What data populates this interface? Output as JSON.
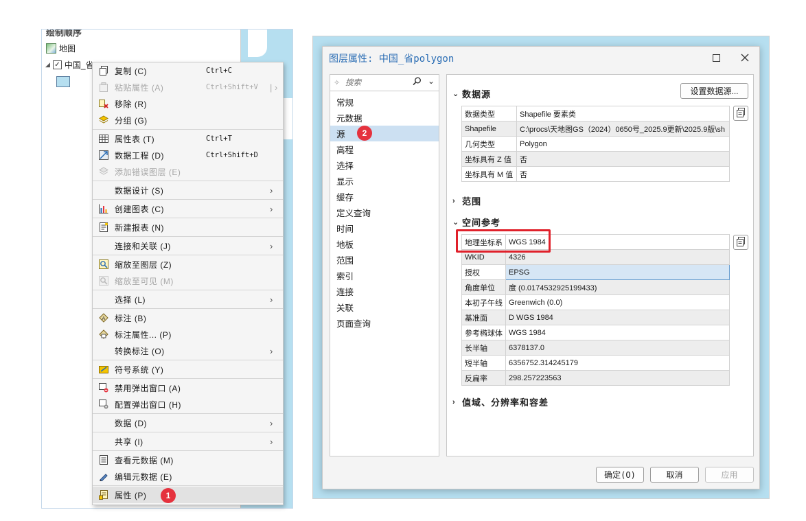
{
  "toc": {
    "title": "绘制顺序",
    "map_label": "地图",
    "layer_label": "中国_省"
  },
  "context_menu": {
    "items": [
      {
        "label": "复制 (C)",
        "shortcut": "Ctrl+C",
        "icon": "copy-icon",
        "disabled": false,
        "submenu": false
      },
      {
        "label": "粘贴属性 (A)",
        "shortcut": "Ctrl+Shift+V",
        "icon": "paste-icon",
        "disabled": true,
        "submenu": true
      },
      {
        "label": "移除 (R)",
        "shortcut": "",
        "icon": "remove-icon",
        "disabled": false,
        "submenu": false
      },
      {
        "label": "分组 (G)",
        "shortcut": "",
        "icon": "group-icon",
        "disabled": false,
        "submenu": false
      },
      {
        "label": "属性表 (T)",
        "shortcut": "Ctrl+T",
        "icon": "attribute-table-icon",
        "disabled": false,
        "submenu": false
      },
      {
        "label": "数据工程 (D)",
        "shortcut": "Ctrl+Shift+D",
        "icon": "data-engineering-icon",
        "disabled": false,
        "submenu": false
      },
      {
        "label": "添加错误图层 (E)",
        "shortcut": "",
        "icon": "error-layer-icon",
        "disabled": true,
        "submenu": false
      },
      {
        "label": "数据设计 (S)",
        "shortcut": "",
        "icon": "",
        "disabled": false,
        "submenu": true
      },
      {
        "label": "创建图表 (C)",
        "shortcut": "",
        "icon": "chart-icon",
        "disabled": false,
        "submenu": true
      },
      {
        "label": "新建报表 (N)",
        "shortcut": "",
        "icon": "report-icon",
        "disabled": false,
        "submenu": false
      },
      {
        "label": "连接和关联 (J)",
        "shortcut": "",
        "icon": "",
        "disabled": false,
        "submenu": true
      },
      {
        "label": "缩放至图层 (Z)",
        "shortcut": "",
        "icon": "zoom-layer-icon",
        "disabled": false,
        "submenu": false
      },
      {
        "label": "缩放至可见 (M)",
        "shortcut": "",
        "icon": "zoom-visible-icon",
        "disabled": true,
        "submenu": false
      },
      {
        "label": "选择 (L)",
        "shortcut": "",
        "icon": "",
        "disabled": false,
        "submenu": true
      },
      {
        "label": "标注 (B)",
        "shortcut": "",
        "icon": "label-icon",
        "disabled": false,
        "submenu": false
      },
      {
        "label": "标注属性... (P)",
        "shortcut": "",
        "icon": "label-properties-icon",
        "disabled": false,
        "submenu": false
      },
      {
        "label": "转换标注 (O)",
        "shortcut": "",
        "icon": "",
        "disabled": false,
        "submenu": true
      },
      {
        "label": "符号系统 (Y)",
        "shortcut": "",
        "icon": "symbology-icon",
        "disabled": false,
        "submenu": false
      },
      {
        "label": "禁用弹出窗口 (A)",
        "shortcut": "",
        "icon": "disable-popup-icon",
        "disabled": false,
        "submenu": false
      },
      {
        "label": "配置弹出窗口 (H)",
        "shortcut": "",
        "icon": "configure-popup-icon",
        "disabled": false,
        "submenu": false
      },
      {
        "label": "数据 (D)",
        "shortcut": "",
        "icon": "",
        "disabled": false,
        "submenu": true
      },
      {
        "label": "共享 (I)",
        "shortcut": "",
        "icon": "",
        "disabled": false,
        "submenu": true
      },
      {
        "label": "查看元数据 (M)",
        "shortcut": "",
        "icon": "view-metadata-icon",
        "disabled": false,
        "submenu": false
      },
      {
        "label": "编辑元数据 (E)",
        "shortcut": "",
        "icon": "edit-metadata-icon",
        "disabled": false,
        "submenu": false
      },
      {
        "label": "属性 (P)",
        "shortcut": "",
        "icon": "properties-icon",
        "disabled": false,
        "submenu": false
      }
    ]
  },
  "badges": {
    "one": "1",
    "two": "2"
  },
  "dialog": {
    "title": "图层属性: 中国_省polygon",
    "search_placeholder": "搜索",
    "nav_items": [
      "常规",
      "元数据",
      "源",
      "高程",
      "选择",
      "显示",
      "缓存",
      "定义查询",
      "时间",
      "地板",
      "范围",
      "索引",
      "连接",
      "关联",
      "页面查询"
    ],
    "selected_nav": "源",
    "data_source": {
      "heading": "数据源",
      "set_button": "设置数据源...",
      "rows": [
        {
          "key": "数据类型",
          "value": "Shapefile 要素类"
        },
        {
          "key": "Shapefile",
          "value": "C:\\procs\\天地图GS（2024）0650号_2025.9更新\\2025.9版\\sh"
        },
        {
          "key": "几何类型",
          "value": "Polygon"
        },
        {
          "key": "坐标具有 Z 值",
          "value": "否"
        },
        {
          "key": "坐标具有 M 值",
          "value": "否"
        }
      ]
    },
    "extent_heading": "范围",
    "spatial_reference": {
      "heading": "空间参考",
      "rows": [
        {
          "key": "地理坐标系",
          "value": "WGS 1984"
        },
        {
          "key": "WKID",
          "value": "4326"
        },
        {
          "key": "授权",
          "value": "EPSG"
        },
        {
          "key": "角度单位",
          "value": "度 (0.0174532925199433)"
        },
        {
          "key": "本初子午线",
          "value": "Greenwich (0.0)"
        },
        {
          "key": "基准面",
          "value": "D WGS 1984"
        },
        {
          "key": "参考椭球体",
          "value": "WGS 1984"
        },
        {
          "key": "长半轴",
          "value": "6378137.0"
        },
        {
          "key": "短半轴",
          "value": "6356752.314245179"
        },
        {
          "key": "反扁率",
          "value": "298.257223563"
        }
      ]
    },
    "domain_heading": "值域、分辨率和容差",
    "ok_button": "确定(O)",
    "cancel_button": "取消",
    "apply_button": "应用"
  },
  "colors": {
    "accent": "#2a6db4",
    "badge": "#e5323e",
    "highlight_box": "#e0202a",
    "map_water": "#b6dff0",
    "nav_selected": "#cce0f2"
  }
}
